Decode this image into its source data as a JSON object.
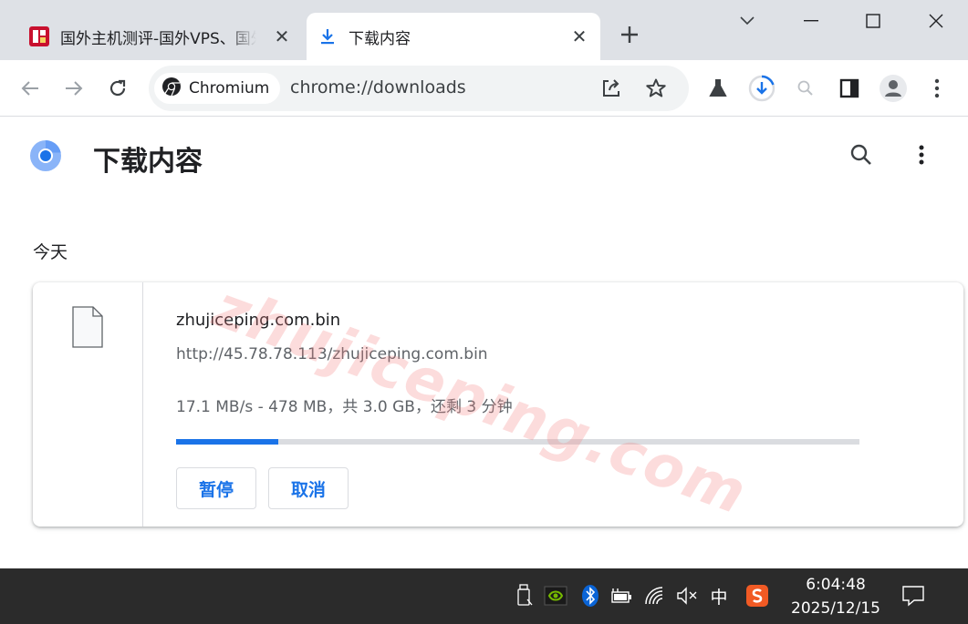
{
  "tabs": [
    {
      "title": "国外主机测评-国外VPS、国外服务器",
      "active": false
    },
    {
      "title": "下载内容",
      "active": true
    }
  ],
  "toolbar": {
    "chip_label": "Chromium",
    "url": "chrome://downloads"
  },
  "page": {
    "title": "下载内容",
    "section_date": "今天"
  },
  "download": {
    "file_name": "zhujiceping.com.bin",
    "url": "http://45.78.78.113/zhujiceping.com.bin",
    "status": "17.1 MB/s - 478 MB，共 3.0 GB，还剩 3 分钟",
    "progress": 0.15,
    "pause_label": "暂停",
    "cancel_label": "取消"
  },
  "watermark": "zhujiceping.com",
  "taskbar": {
    "ime": "中",
    "time": "6:04:48",
    "date": "2025/12/15"
  },
  "colors": {
    "accent": "#1a73e8",
    "tabstrip": "#dee1e6",
    "taskbar": "#2b2b2b"
  }
}
